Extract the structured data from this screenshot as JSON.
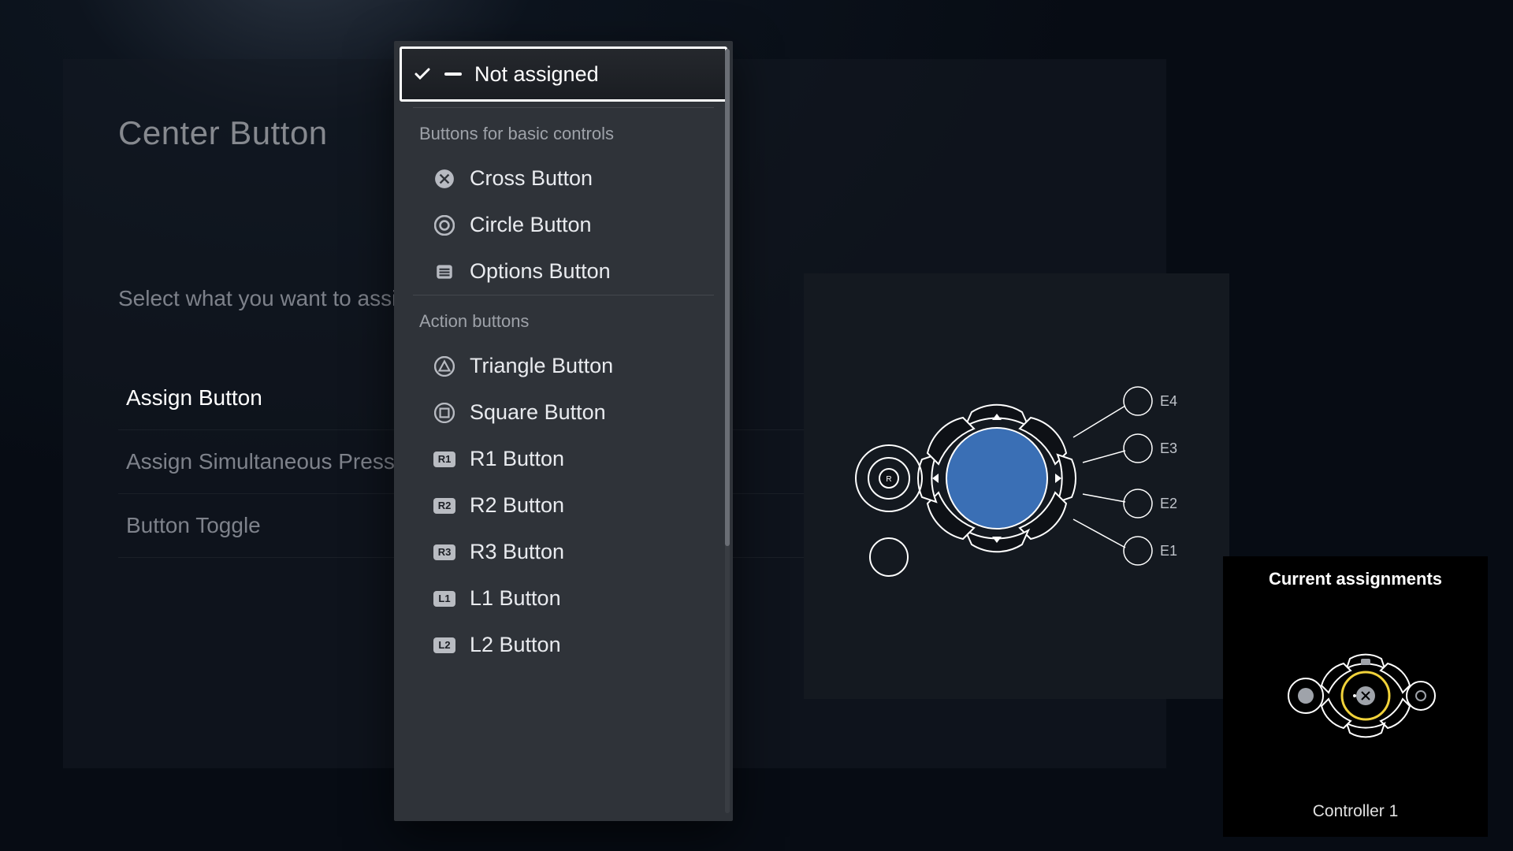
{
  "page": {
    "title": "Center Button",
    "instruction": "Select what you want to assign to this button."
  },
  "tabs": [
    {
      "label": "Assign Button",
      "active": true
    },
    {
      "label": "Assign Simultaneous Press",
      "active": false
    },
    {
      "label": "Button Toggle",
      "active": false
    }
  ],
  "dropdown": {
    "selected": {
      "label": "Not assigned",
      "icon": "dash"
    },
    "sections": [
      {
        "label": "Buttons for basic controls",
        "items": [
          {
            "label": "Cross Button",
            "icon": "cross"
          },
          {
            "label": "Circle Button",
            "icon": "circle"
          },
          {
            "label": "Options Button",
            "icon": "options"
          }
        ]
      },
      {
        "label": "Action buttons",
        "items": [
          {
            "label": "Triangle Button",
            "icon": "triangle"
          },
          {
            "label": "Square Button",
            "icon": "square"
          },
          {
            "label": "R1 Button",
            "icon": "badge",
            "badge": "R1"
          },
          {
            "label": "R2 Button",
            "icon": "badge",
            "badge": "R2"
          },
          {
            "label": "R3 Button",
            "icon": "badge",
            "badge": "R3"
          },
          {
            "label": "L1 Button",
            "icon": "badge",
            "badge": "L1"
          },
          {
            "label": "L2 Button",
            "icon": "badge",
            "badge": "L2"
          }
        ]
      }
    ]
  },
  "preview": {
    "extension_labels": [
      "E4",
      "E3",
      "E2",
      "E1"
    ]
  },
  "mini": {
    "title": "Current assignments",
    "controller_label": "Controller 1"
  }
}
